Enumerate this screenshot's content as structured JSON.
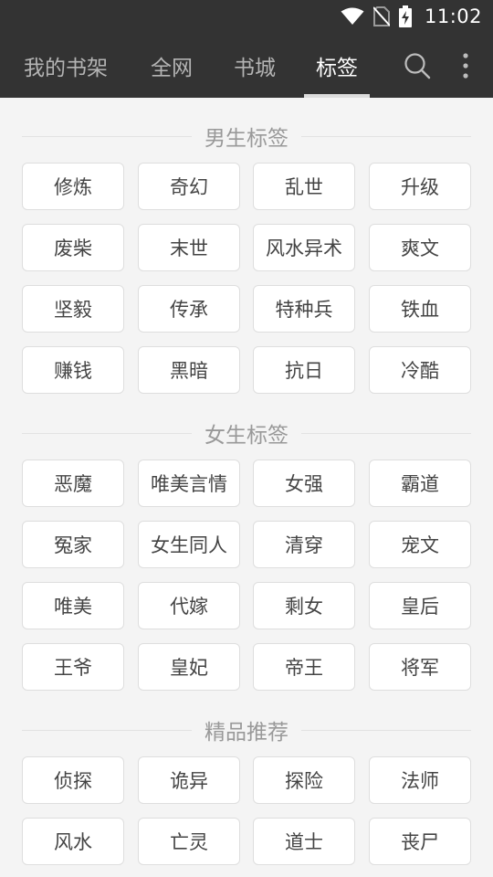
{
  "status_bar": {
    "time": "11:02",
    "icons": [
      "wifi-icon",
      "no-sim-icon",
      "battery-charging-icon"
    ]
  },
  "toolbar": {
    "tabs": [
      {
        "label": "我的书架",
        "active": false
      },
      {
        "label": "全网",
        "active": false
      },
      {
        "label": "书城",
        "active": false
      },
      {
        "label": "标签",
        "active": true
      }
    ],
    "actions": [
      "search-icon",
      "more-vert-icon"
    ]
  },
  "colors": {
    "toolbar_bg": "#333333",
    "page_bg": "#f4f4f4",
    "tag_bg": "#ffffff",
    "tag_text": "#444444",
    "section_text": "#999999"
  },
  "sections": [
    {
      "title": "男生标签",
      "tags": [
        "修炼",
        "奇幻",
        "乱世",
        "升级",
        "废柴",
        "末世",
        "风水异术",
        "爽文",
        "坚毅",
        "传承",
        "特种兵",
        "铁血",
        "赚钱",
        "黑暗",
        "抗日",
        "冷酷"
      ]
    },
    {
      "title": "女生标签",
      "tags": [
        "恶魔",
        "唯美言情",
        "女强",
        "霸道",
        "冤家",
        "女生同人",
        "清穿",
        "宠文",
        "唯美",
        "代嫁",
        "剩女",
        "皇后",
        "王爷",
        "皇妃",
        "帝王",
        "将军"
      ]
    },
    {
      "title": "精品推荐",
      "tags": [
        "侦探",
        "诡异",
        "探险",
        "法师",
        "风水",
        "亡灵",
        "道士",
        "丧尸"
      ]
    }
  ]
}
